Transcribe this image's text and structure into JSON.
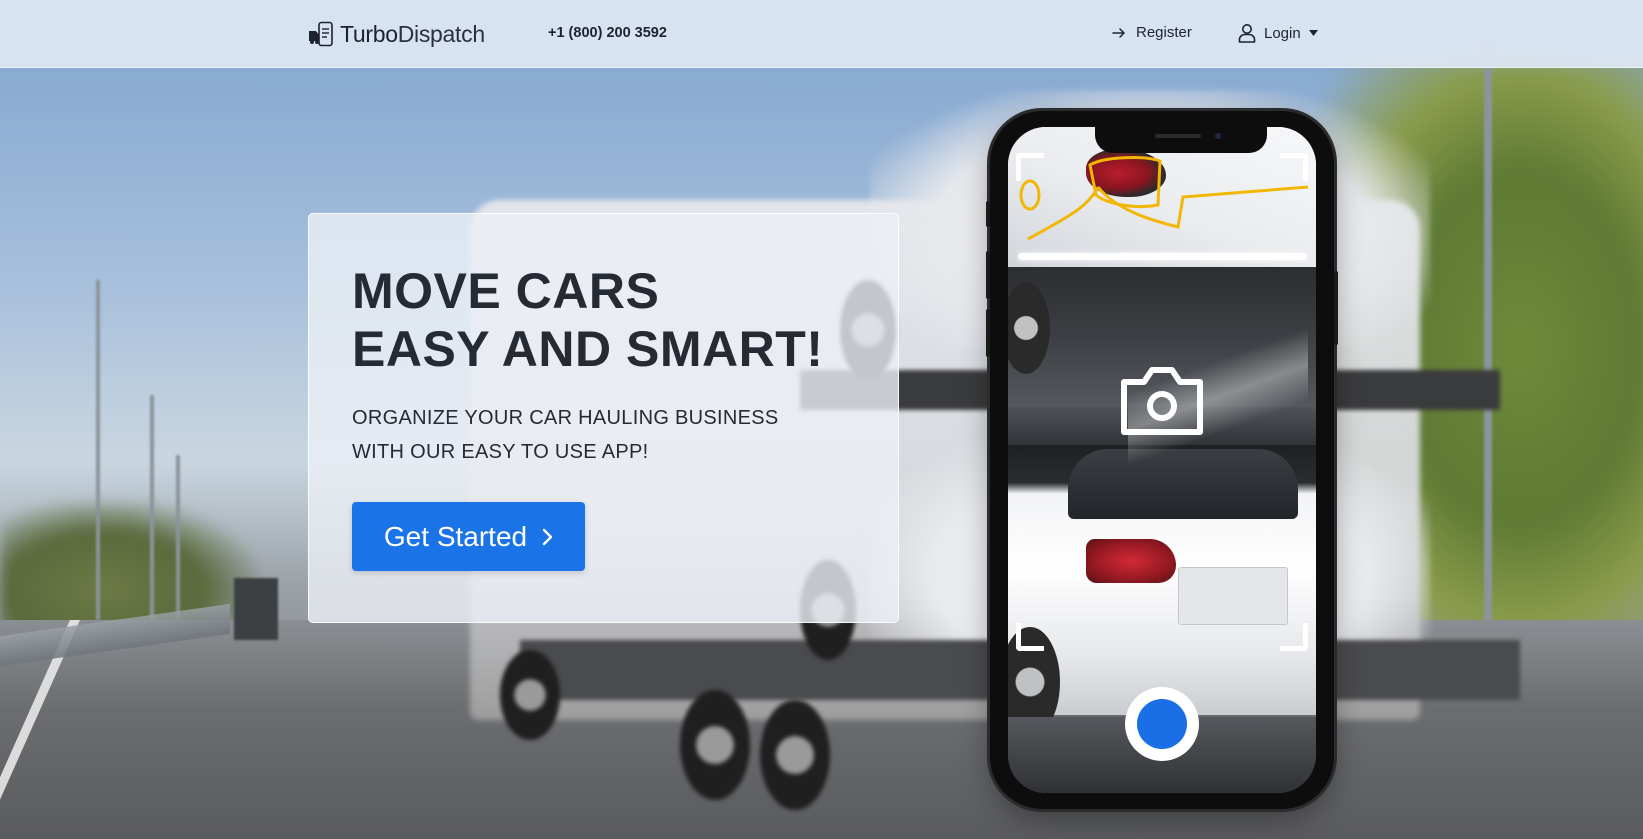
{
  "header": {
    "logo": {
      "name_part1": "Turbo",
      "name_part2": "Dispatch"
    },
    "phone": "+1 (800) 200 3592",
    "register_label": "Register",
    "login_label": "Login"
  },
  "hero": {
    "title_line1": "MOVE CARS",
    "title_line2": "EASY AND SMART!",
    "subtitle_line1": "ORGANIZE YOUR CAR HAULING BUSINESS",
    "subtitle_line2": "WITH OUR EASY TO USE APP!",
    "cta_label": "Get Started"
  },
  "colors": {
    "primary_blue": "#1a74e8",
    "header_bg": "#dee7f3",
    "text_dark": "#262a33",
    "scan_overlay": "#ffffff",
    "scan_outline": "#f2b705"
  },
  "icons": {
    "logo": "truck-phone-icon",
    "register": "arrow-right-icon",
    "login": "user-icon",
    "login_caret": "caret-down-icon",
    "cta": "chevron-right-icon",
    "phone_overlay": "camera-icon",
    "shutter": "shutter-button"
  }
}
